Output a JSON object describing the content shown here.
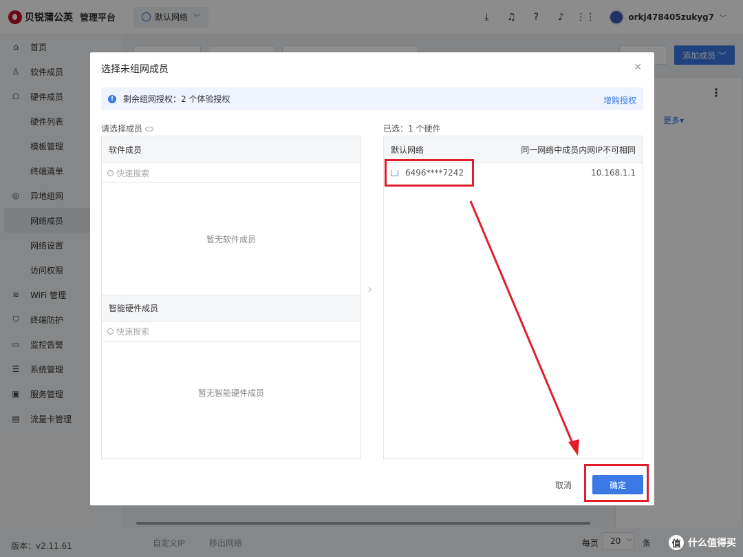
{
  "header": {
    "logo_text": "贝锐蒲公英",
    "platform": "管理平台",
    "network_select": "默认网络",
    "username": "orkj478405zukyg7",
    "icons": [
      "download-icon",
      "headset-icon",
      "help-icon",
      "bell-icon",
      "apps-grid-icon"
    ]
  },
  "sidebar": {
    "items": [
      {
        "label": "首页",
        "icon": "home-icon"
      },
      {
        "label": "软件成员",
        "icon": "user-icon"
      },
      {
        "label": "硬件成员",
        "icon": "hardware-icon"
      },
      {
        "label": "硬件列表",
        "sub": true
      },
      {
        "label": "模板管理",
        "sub": true
      },
      {
        "label": "终端清单",
        "sub": true
      },
      {
        "label": "异地组网",
        "icon": "network-icon"
      },
      {
        "label": "网络成员",
        "sub": true,
        "active": true
      },
      {
        "label": "网络设置",
        "sub": true
      },
      {
        "label": "访问权限",
        "sub": true
      },
      {
        "label": "WiFi 管理",
        "icon": "wifi-icon"
      },
      {
        "label": "终端防护",
        "icon": "shield-icon"
      },
      {
        "label": "监控告警",
        "icon": "monitor-icon"
      },
      {
        "label": "系统管理",
        "icon": "settings-icon"
      },
      {
        "label": "服务管理",
        "icon": "service-icon"
      },
      {
        "label": "流量卡管理",
        "icon": "sim-icon"
      }
    ],
    "version": "版本：v2.11.61"
  },
  "background": {
    "add_member": "添加成员",
    "more": "更多",
    "custom_ip": "自定义IP",
    "remove_network": "移出网络",
    "per_page": "每页",
    "page_size": "20",
    "per_page_tail": "条"
  },
  "modal": {
    "title": "选择未组网成员",
    "notice": "剩余组网授权：2 个体验授权",
    "buy_license": "增购授权",
    "select_label": "请选择成员",
    "selected_label": "已选：1 个硬件",
    "software_members": "软件成员",
    "software_search_placeholder": "快速搜索",
    "software_empty": "暂无软件成员",
    "hardware_members": "智能硬件成员",
    "hardware_search_placeholder": "快速搜索",
    "hardware_empty": "暂无智能硬件成员",
    "right_head_left": "默认网络",
    "right_head_right": "同一网络中成员内网IP不可相同",
    "selected_members": [
      {
        "id": "6496****7242",
        "ip": "10.168.1.1"
      }
    ],
    "cancel": "取消",
    "confirm": "确定"
  },
  "watermark": {
    "circle": "值",
    "text": "什么值得买"
  },
  "colors": {
    "accent": "#3a78e6",
    "annotation": "#e21d2b",
    "brand": "#c8102e"
  }
}
